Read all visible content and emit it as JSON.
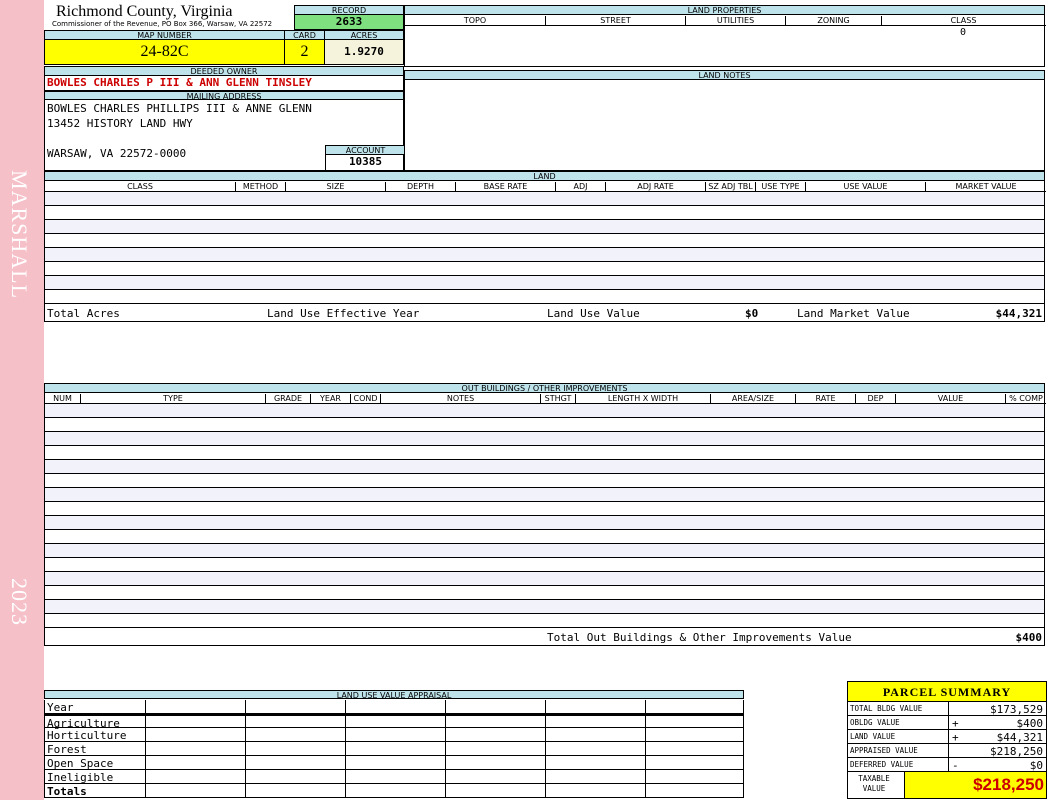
{
  "sidebar": {
    "label_top": "MARSHALL",
    "label_bottom": "2023"
  },
  "header": {
    "county": "Richmond County, Virginia",
    "commissioner": "Commissioner of the Revenue, PO Box 366, Warsaw, VA 22572",
    "record_label": "RECORD",
    "record_value": "2633",
    "map_number_label": "MAP NUMBER",
    "map_number": "24-82C",
    "card_label": "CARD",
    "card_value": "2",
    "acres_label": "ACRES",
    "acres_value": "1.9270",
    "deeded_owner_label": "DEEDED OWNER",
    "deeded_owner": "BOWLES CHARLES P III & ANN GLENN TINSLEY",
    "mailing_address_label": "MAILING ADDRESS",
    "mailing_line1": "BOWLES CHARLES PHILLIPS III & ANNE GLENN",
    "mailing_line2": "13452 HISTORY LAND HWY",
    "mailing_line3": "WARSAW, VA 22572-0000",
    "account_label": "ACCOUNT",
    "account_value": "10385"
  },
  "land_properties": {
    "title": "LAND PROPERTIES",
    "columns": [
      "TOPO",
      "STREET",
      "UTILITIES",
      "ZONING",
      "CLASS"
    ],
    "class_value": "0"
  },
  "land_notes": {
    "title": "LAND NOTES"
  },
  "land": {
    "title": "LAND",
    "columns": [
      "CLASS",
      "METHOD",
      "SIZE",
      "DEPTH",
      "BASE RATE",
      "ADJ",
      "ADJ RATE",
      "SZ ADJ TBL",
      "USE TYPE",
      "USE VALUE",
      "MARKET VALUE"
    ],
    "total_acres_label": "Total Acres",
    "effective_year_label": "Land Use Effective Year",
    "land_use_value_label": "Land Use Value",
    "land_use_value": "$0",
    "land_market_value_label": "Land Market Value",
    "land_market_value": "$44,321"
  },
  "outbuildings": {
    "title": "OUT BUILDINGS / OTHER IMPROVEMENTS",
    "columns": [
      "NUM",
      "TYPE",
      "GRADE",
      "YEAR",
      "COND",
      "NOTES",
      "STHGT",
      "LENGTH X WIDTH",
      "AREA/SIZE",
      "RATE",
      "DEP",
      "VALUE",
      "% COMP"
    ],
    "total_label": "Total Out Buildings & Other Improvements Value",
    "total_value": "$400"
  },
  "land_use_appraisal": {
    "title": "LAND USE VALUE APPRAISAL",
    "rows": [
      "Year",
      "Agriculture",
      "Horticulture",
      "Forest",
      "Open Space",
      "Ineligible",
      "Totals"
    ]
  },
  "parcel_summary": {
    "title": "PARCEL SUMMARY",
    "rows": [
      {
        "label": "TOTAL BLDG VALUE",
        "sign": "",
        "value": "$173,529"
      },
      {
        "label": "OBLDG VALUE",
        "sign": "+",
        "value": "$400"
      },
      {
        "label": "LAND VALUE",
        "sign": "+",
        "value": "$44,321"
      },
      {
        "label": "APPRAISED VALUE",
        "sign": "",
        "value": "$218,250"
      },
      {
        "label": "DEFERRED VALUE",
        "sign": "-",
        "value": "$0"
      }
    ],
    "taxable_label_1": "TAXABLE",
    "taxable_label_2": "VALUE",
    "taxable_value": "$218,250"
  },
  "colors": {
    "header_band": "#bfe3ea",
    "highlight_yellow": "#ffff00",
    "record_green": "#7fe07f",
    "acres_cream": "#f5f3dc",
    "owner_red": "#cc0000",
    "sidebar_pink": "#f6c0c8",
    "row_stripe": "#f2f3fa"
  }
}
